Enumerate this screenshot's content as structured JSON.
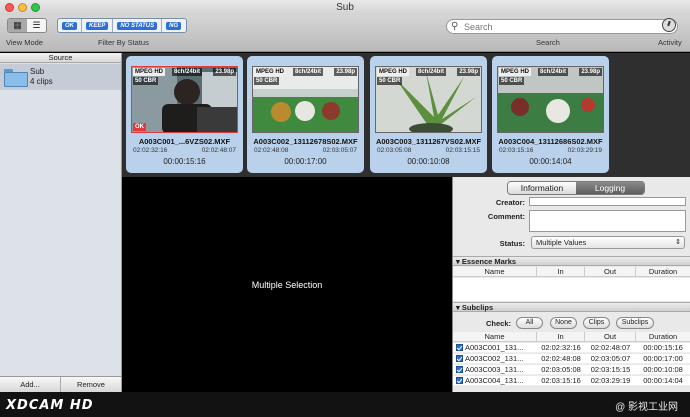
{
  "window": {
    "title": "Sub"
  },
  "toolbar": {
    "view_mode_label": "View Mode",
    "filter_label": "Filter By Status",
    "filters": [
      "OK",
      "KEEP",
      "NO STATUS",
      "NG"
    ],
    "search_placeholder": "Search",
    "search_label": "Search",
    "activity_label": "Activity"
  },
  "sidebar": {
    "header": "Source",
    "item": {
      "name": "Sub",
      "count": "4 clips"
    },
    "add_button": "Add...",
    "remove_button": "Remove"
  },
  "clips": [
    {
      "name": "A003C001_...6VZS02.MXF",
      "codec": "MPEG HD",
      "audio": "8ch/24bit",
      "fps": "23.98p",
      "bitrate": "50 CBR",
      "tc_in": "02:02:32:16",
      "tc_out": "02:02:48:07",
      "duration": "00:00:15:16",
      "status": "OK",
      "scene": "interview"
    },
    {
      "name": "A003C002_13112678S02.MXF",
      "codec": "MPEG HD",
      "audio": "8ch/24bit",
      "fps": "23.98p",
      "bitrate": "50 CBR",
      "tc_in": "02:02:48:08",
      "tc_out": "02:03:05:07",
      "duration": "00:00:17:00",
      "status": "",
      "scene": "billiards"
    },
    {
      "name": "A003C003_1311267VS02.MXF",
      "codec": "MPEG HD",
      "audio": "8ch/24bit",
      "fps": "23.98p",
      "bitrate": "50 CBR",
      "tc_in": "02:03:05:08",
      "tc_out": "02:03:15:15",
      "duration": "00:00:10:08",
      "status": "",
      "scene": "plant"
    },
    {
      "name": "A003C004_13112686S02.MXF",
      "codec": "MPEG HD",
      "audio": "8ch/24bit",
      "fps": "23.98p",
      "bitrate": "50 CBR",
      "tc_in": "02:03:15:16",
      "tc_out": "02:03:29:19",
      "duration": "00:00:14:04",
      "status": "",
      "scene": "billiards-2"
    }
  ],
  "viewer": {
    "text": "Multiple Selection"
  },
  "panel": {
    "tabs": [
      "Information",
      "Logging"
    ],
    "active_tab": "Logging",
    "creator_label": "Creator:",
    "comment_label": "Comment:",
    "status_label": "Status:",
    "status_value": "Multiple Values",
    "essence_marks_header": "Essence Marks",
    "essence_cols": [
      "Name",
      "In",
      "Out",
      "Duration"
    ],
    "subclips_header": "Subclips",
    "check_label": "Check:",
    "check_buttons": [
      "All",
      "None",
      "Clips",
      "Subclips"
    ],
    "subclip_cols": [
      "Name",
      "In",
      "Out",
      "Duration"
    ],
    "subclips": [
      {
        "name": "A003C001_131...",
        "in": "02:02:32:16",
        "out": "02:02:48:07",
        "duration": "00:00:15:16"
      },
      {
        "name": "A003C002_131...",
        "in": "02:02:48:08",
        "out": "02:03:05:07",
        "duration": "00:00:17:00"
      },
      {
        "name": "A003C003_131...",
        "in": "02:03:05:08",
        "out": "02:03:15:15",
        "duration": "00:00:10:08"
      },
      {
        "name": "A003C004_131...",
        "in": "02:03:15:16",
        "out": "02:03:29:19",
        "duration": "00:00:14:04"
      }
    ]
  },
  "footer": {
    "brand": "XDCAM HD",
    "watermark": "@ 影视工业网"
  },
  "colors": {
    "accent": "#2c6fd6",
    "clip_card": "#bad1eb",
    "ok_badge": "#e23b3b"
  }
}
